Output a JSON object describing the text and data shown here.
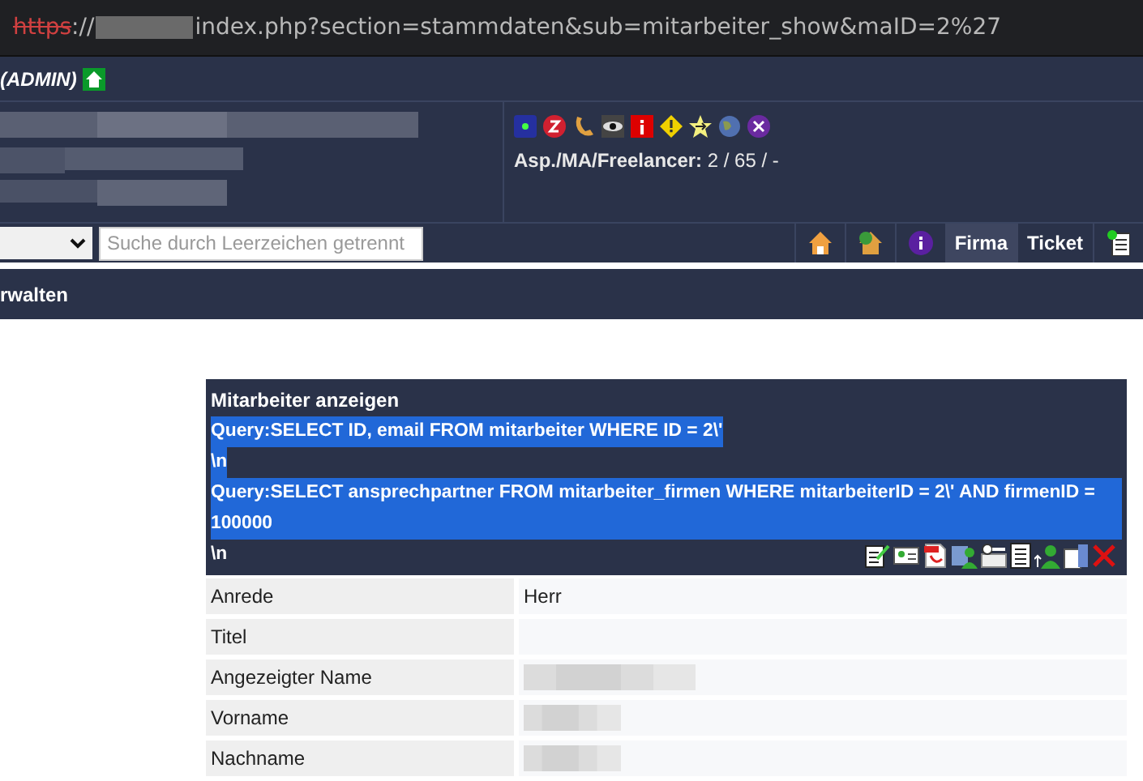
{
  "address_bar": {
    "scheme": "https",
    "separator": "://",
    "host_redacted": true,
    "path": "index.php?section=stammdaten&sub=mitarbeiter_show&maID=2%27"
  },
  "header": {
    "role": "(ADMIN)"
  },
  "info_panel": {
    "stats_label": "Asp./MA/Freelancer:",
    "stats_value": "2 / 65 / -"
  },
  "toolbar": {
    "search": {
      "placeholder": "Suche durch Leerzeichen getrennt"
    },
    "tabs": [
      {
        "label": "Firma",
        "selected": true
      },
      {
        "label": "Ticket",
        "selected": false
      }
    ]
  },
  "section_bar": {
    "title": "rwalten"
  },
  "panel": {
    "title": "Mitarbeiter anzeigen",
    "lines": [
      {
        "text": "Query:SELECT ID, email FROM mitarbeiter WHERE ID = 2\\'",
        "highlighted": true
      },
      {
        "text": "\\n",
        "highlighted": true
      },
      {
        "text": "Query:SELECT ansprechpartner FROM mitarbeiter_firmen WHERE mitarbeiterID = 2\\' AND firmenID = 100000",
        "highlighted": true
      },
      {
        "text": "\\n",
        "highlighted": false
      }
    ]
  },
  "table": {
    "rows": [
      {
        "label": "Anrede",
        "value": "Herr",
        "redacted": false
      },
      {
        "label": "Titel",
        "redacted": false
      },
      {
        "label": "Angezeigter Name",
        "redacted": true
      },
      {
        "label": "Vorname",
        "redacted": true
      },
      {
        "label": "Nachname",
        "redacted": true
      }
    ]
  }
}
